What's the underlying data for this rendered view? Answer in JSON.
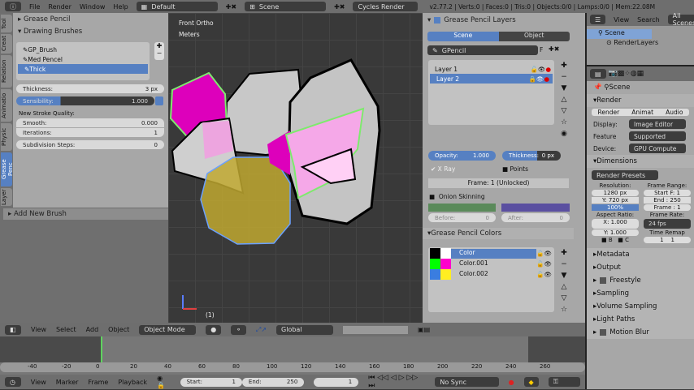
{
  "topbar": {
    "menus": [
      "File",
      "Render",
      "Window",
      "Help"
    ],
    "layout": "Default",
    "scene": "Scene",
    "engine": "Cycles Render",
    "status": "v2.77.2 | Verts:0 | Faces:0 | Tris:0 | Objects:0/0 | Lamps:0/0 | Mem:22.08M"
  },
  "toolshelf": {
    "tabs": [
      "Tool",
      "Creat",
      "Relation",
      "Animatio",
      "Physic",
      "Grease Penc",
      "Layer"
    ],
    "grease_pencil": "Grease Pencil",
    "drawing_brushes": "Drawing Brushes",
    "brushes": [
      "GP_Brush",
      "Med Pencel",
      "Thick"
    ],
    "selected_brush": "Thick",
    "thickness_label": "Thickness:",
    "thickness": "3 px",
    "sensibility_label": "Sensibility:",
    "sensibility": "1.000",
    "sensibility_fraction": 0.8,
    "quality_label": "New Stroke Quality:",
    "smooth_label": "Smooth:",
    "smooth": "0.000",
    "iterations_label": "Iterations:",
    "iterations": "1",
    "subdiv_label": "Subdivision Steps:",
    "subdiv": "0",
    "add_brush": "Add New Brush"
  },
  "viewport": {
    "view": "Front Ortho",
    "units": "Meters",
    "frame": "(1)"
  },
  "view_header": {
    "menus": [
      "View",
      "Select",
      "Add",
      "Object"
    ],
    "mode": "Object Mode",
    "orientation": "Global"
  },
  "gp_layers": {
    "title": "Grease Pencil Layers",
    "tabs": [
      "Scene",
      "Object"
    ],
    "active_tab": "Scene",
    "datablock": "GPencil",
    "fake": "F",
    "layers": [
      "Layer 1",
      "Layer 2"
    ],
    "active_layer": "Layer 2",
    "opacity_label": "Opacity:",
    "opacity": "1.000",
    "thickness_label": "Thickness:",
    "thickness": "0 px",
    "xray": "X Ray",
    "points": "Points",
    "frame": "Frame: 1 (Unlocked)",
    "onion": "Onion Skinning",
    "before_label": "Before:",
    "before": "0",
    "after_label": "After:",
    "after": "0"
  },
  "gp_colors": {
    "title": "Grease Pencil Colors",
    "colors": [
      {
        "name": "Color",
        "stroke": "#000000",
        "fill": "#ffffff"
      },
      {
        "name": "Color.001",
        "stroke": "#00ff00",
        "fill": "#ff00cc"
      },
      {
        "name": "Color.002",
        "stroke": "#3a7de0",
        "fill": "#ffee22"
      }
    ],
    "active": "Color"
  },
  "outliner": {
    "menus": [
      "View",
      "Search"
    ],
    "filter": "All Scenes",
    "items": [
      "Scene",
      "RenderLayers"
    ]
  },
  "properties": {
    "context": "Scene",
    "render_title": "Render",
    "render_buttons": [
      "Render",
      "Animat",
      "Audio"
    ],
    "display_label": "Display:",
    "display": "Image Editor",
    "feature_label": "Feature",
    "feature": "Supported",
    "device_label": "Device:",
    "device": "GPU Compute",
    "dimensions": "Dimensions",
    "presets": "Render Presets",
    "resolution_label": "Resolution:",
    "res_x": "1280 px",
    "res_y": "Y: 720 px",
    "res_pct": "100%",
    "frame_range_label": "Frame Range:",
    "start": "Start F: 1",
    "end": "End : 250",
    "frame": "Frame : 1",
    "aspect_label": "Aspect Ratio:",
    "asp_x": "X:  1.000",
    "asp_y": "Y:  1.000",
    "b": "B",
    "c": "C",
    "frame_rate_label": "Frame Rate:",
    "fps": "24 fps",
    "remap_label": "Time Remap",
    "remap_old": "1",
    "remap_new": "1",
    "sections": [
      "Metadata",
      "Output",
      "Freestyle",
      "Sampling",
      "Volume Sampling",
      "Light Paths",
      "Motion Blur"
    ]
  },
  "timeline": {
    "ticks": [
      "-40",
      "-20",
      "0",
      "20",
      "40",
      "60",
      "80",
      "100",
      "120",
      "140",
      "160",
      "180",
      "200",
      "220",
      "240",
      "260"
    ],
    "current_frame": 0,
    "menus": [
      "View",
      "Marker",
      "Frame",
      "Playback"
    ],
    "start_label": "Start:",
    "start": "1",
    "end_label": "End:",
    "end": "250",
    "current": "1",
    "sync": "No Sync"
  }
}
